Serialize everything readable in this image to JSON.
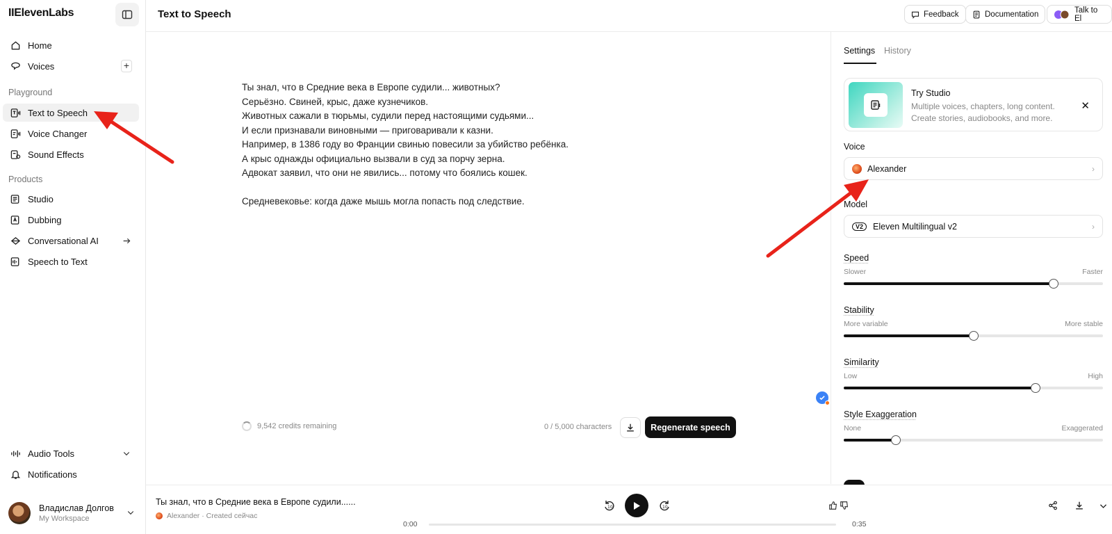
{
  "sidebar": {
    "logo": "IIElevenLabs",
    "nav_top": [
      {
        "label": "Home",
        "icon": "home-icon"
      },
      {
        "label": "Voices",
        "icon": "voices-icon"
      }
    ],
    "group_playground": "Playground",
    "playground": [
      {
        "label": "Text to Speech",
        "icon": "text-to-speech-icon",
        "active": true
      },
      {
        "label": "Voice Changer",
        "icon": "voice-changer-icon"
      },
      {
        "label": "Sound Effects",
        "icon": "sound-effects-icon"
      }
    ],
    "group_products": "Products",
    "products": [
      {
        "label": "Studio",
        "icon": "studio-icon"
      },
      {
        "label": "Dubbing",
        "icon": "dubbing-icon"
      },
      {
        "label": "Conversational AI",
        "icon": "conversational-ai-icon"
      },
      {
        "label": "Speech to Text",
        "icon": "speech-to-text-icon"
      }
    ],
    "bottom": [
      {
        "label": "Audio Tools",
        "icon": "audio-tools-icon"
      },
      {
        "label": "Notifications",
        "icon": "bell-icon"
      }
    ],
    "user": {
      "name": "Владислав Долгов",
      "workspace": "My Workspace"
    }
  },
  "header": {
    "title": "Text to Speech",
    "feedback": "Feedback",
    "documentation": "Documentation",
    "talk": "Talk to El"
  },
  "editor": {
    "lines": [
      "Ты знал, что в Средние века в Европе судили... животных?",
      "Серьёзно. Свиней, крыс, даже кузнечиков.",
      "Животных сажали в тюрьмы, судили перед настоящими судьями...",
      "И если признавали виновными — приговаривали к казни.",
      "Например, в 1386 году во Франции свинью повесили за убийство ребёнка.",
      "А крыс однажды официально вызвали в суд за порчу зерна.",
      "Адвокат заявил, что они не явились... потому что боялись кошек.",
      "",
      "Средневековье: когда даже мышь могла попасть под следствие."
    ],
    "credits": "9,542 credits remaining",
    "char_count": "0 / 5,000 characters",
    "regenerate": "Regenerate speech"
  },
  "panel": {
    "tabs": [
      "Settings",
      "History"
    ],
    "promo": {
      "title": "Try Studio",
      "desc_line1": "Multiple voices, chapters, long content.",
      "desc_line2": "Create stories, audiobooks, and more."
    },
    "voice_label": "Voice",
    "voice_value": "Alexander",
    "model_label": "Model",
    "model_badge": "V2",
    "model_value": "Eleven Multilingual v2",
    "sliders": [
      {
        "label": "Speed",
        "min": "Slower",
        "max": "Faster",
        "value": 0.81
      },
      {
        "label": "Stability",
        "min": "More variable",
        "max": "More stable",
        "value": 0.5
      },
      {
        "label": "Similarity",
        "min": "Low",
        "max": "High",
        "value": 0.74
      },
      {
        "label": "Style Exaggeration",
        "min": "None",
        "max": "Exaggerated",
        "value": 0.2
      }
    ]
  },
  "player": {
    "title": "Ты знал, что в Средние века в Европе судили......",
    "meta": "Alexander · Created сейчас",
    "time_current": "0:00",
    "time_total": "0:35"
  },
  "colors": {
    "accent": "#111111",
    "annotation": "#e8231a",
    "promo_gradient": "#3fd6c0"
  }
}
